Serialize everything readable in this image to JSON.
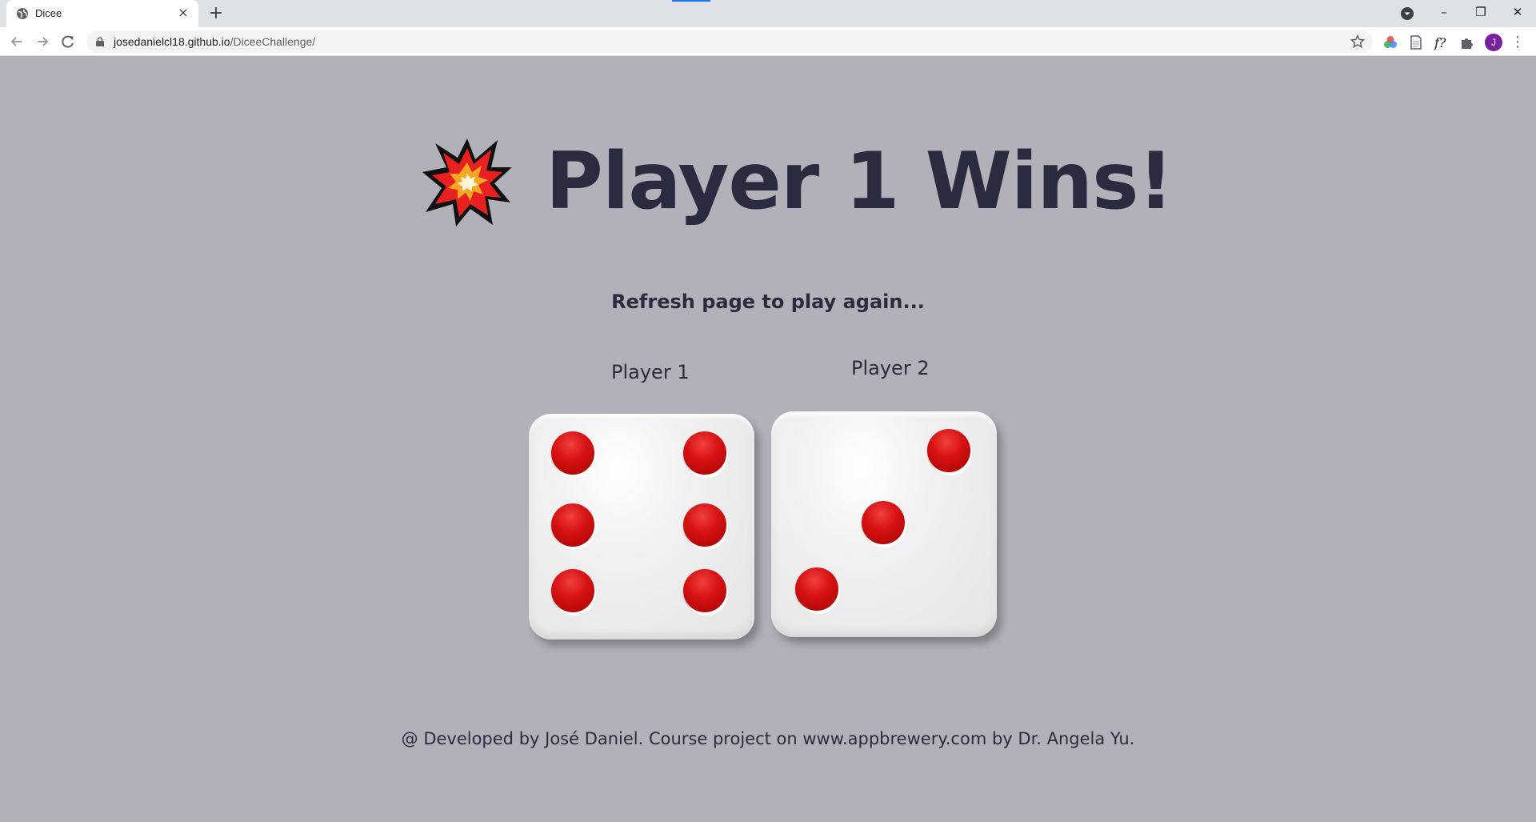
{
  "browser": {
    "tab_title": "Dicee",
    "new_tab_label": "+",
    "close_tab_label": "×",
    "url_host": "josedanielcl18.github.io",
    "url_path": "/DiceeChallenge/",
    "profile_initial": "J",
    "window_controls": {
      "minimize": "–",
      "maximize": "❐",
      "close": "✕"
    }
  },
  "page": {
    "headline": "Player 1 Wins!",
    "subtitle": "Refresh page to play again...",
    "players": [
      {
        "label": "Player 1",
        "die_value": 6
      },
      {
        "label": "Player 2",
        "die_value": 3
      }
    ],
    "footer": "@ Developed by José Daniel. Course project on www.appbrewery.com by Dr. Angela Yu."
  },
  "colors": {
    "background": "#b2b1b9",
    "text": "#2b2b40",
    "pip": "#d81313"
  },
  "icons": [
    "globe-icon",
    "back-icon",
    "forward-icon",
    "reload-icon",
    "lock-icon",
    "star-icon",
    "color-wheel-icon",
    "page-icon",
    "font-icon",
    "puzzle-icon",
    "boom-icon"
  ]
}
